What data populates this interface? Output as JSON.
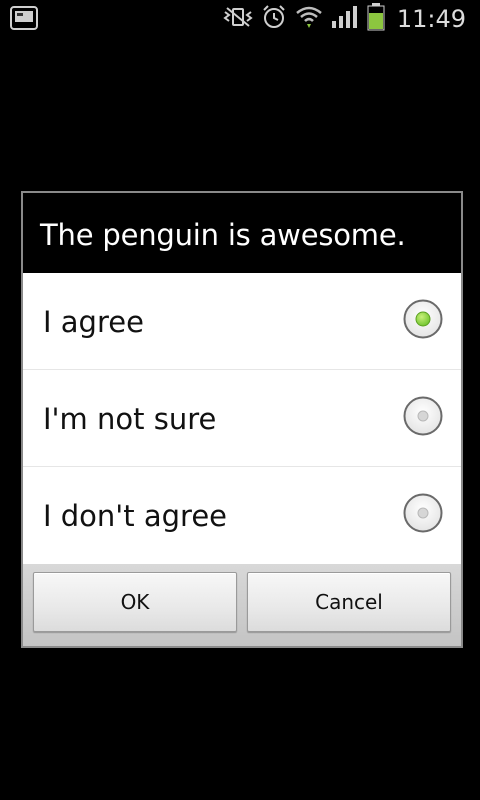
{
  "status_bar": {
    "time": "11:49",
    "icons": [
      "screen-icon",
      "vibrate-icon",
      "alarm-icon",
      "wifi-icon",
      "signal-icon",
      "battery-icon"
    ],
    "battery_color": "#8cc63f"
  },
  "dialog": {
    "title": "The penguin is awesome.",
    "options": [
      {
        "label": "I agree",
        "selected": true
      },
      {
        "label": "I'm not sure",
        "selected": false
      },
      {
        "label": "I don't agree",
        "selected": false
      }
    ],
    "buttons": {
      "ok": "OK",
      "cancel": "Cancel"
    },
    "selected_color": "#7ed321"
  }
}
